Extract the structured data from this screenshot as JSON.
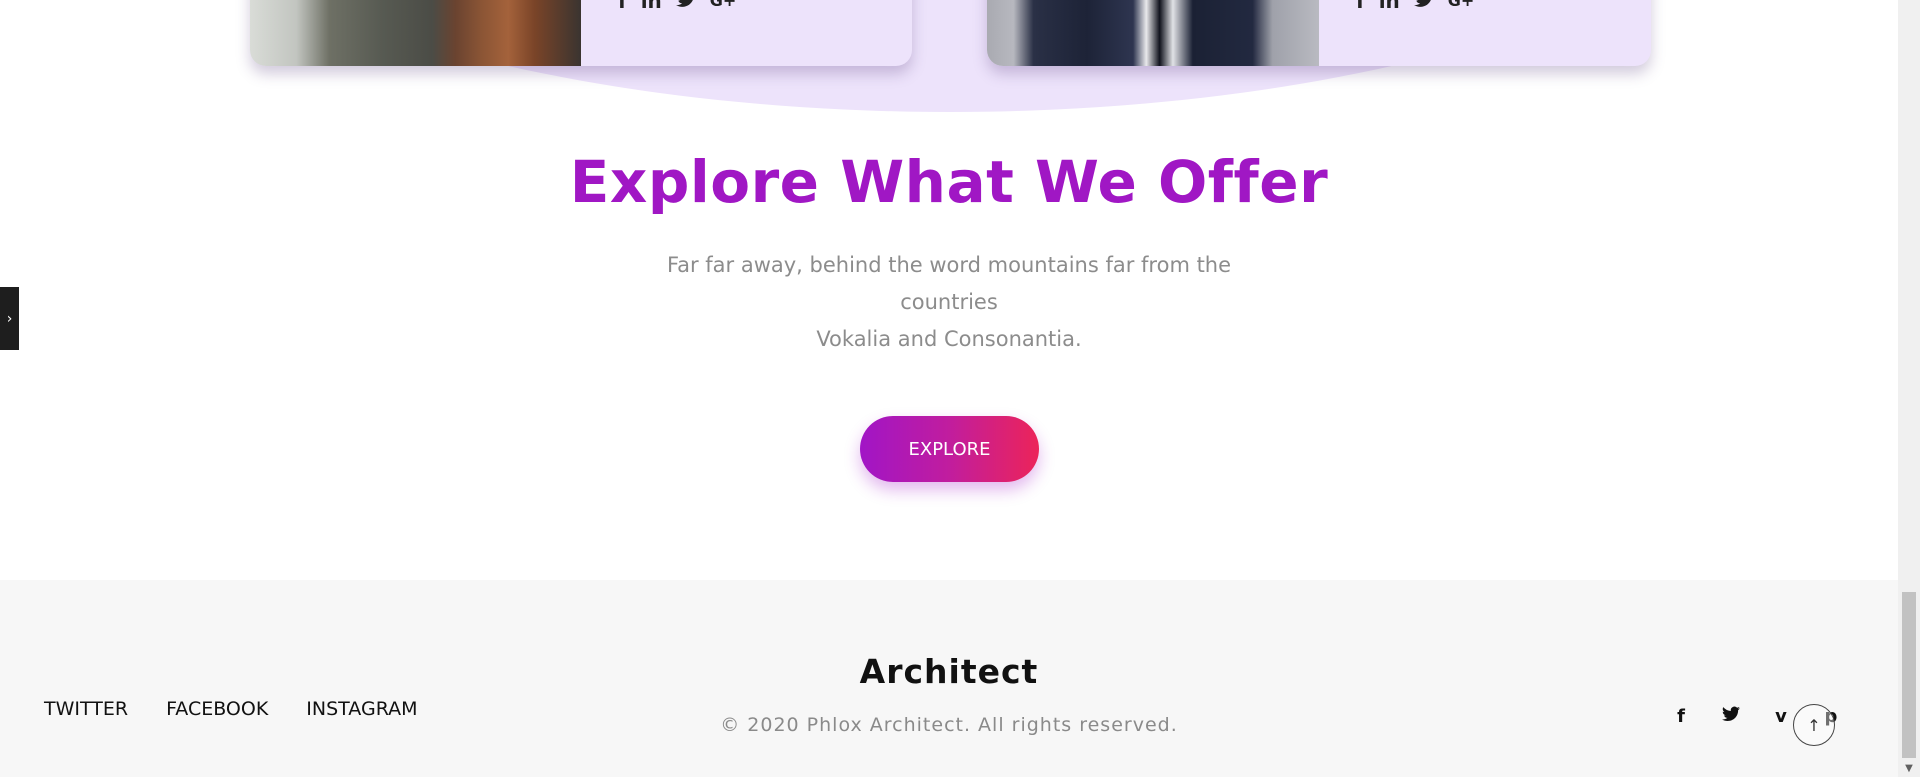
{
  "team": {
    "cards": [
      {
        "icons": [
          "facebook-icon",
          "linkedin-icon",
          "twitter-icon",
          "google-plus-icon"
        ]
      },
      {
        "icons": [
          "facebook-icon",
          "linkedin-icon",
          "twitter-icon",
          "google-plus-icon"
        ]
      }
    ],
    "icon_glyphs": {
      "facebook": "f",
      "linkedin": "in",
      "twitter": "🐦",
      "google_plus": "G+"
    }
  },
  "offer": {
    "heading": "Explore What We Offer",
    "subtitle_line1": "Far far away, behind the word mountains far from the countries",
    "subtitle_line2": "Vokalia and Consonantia.",
    "button_label": "EXPLORE"
  },
  "side_tab": {
    "glyph": "›"
  },
  "footer": {
    "links": [
      "TWITTER",
      "FACEBOOK",
      "INSTAGRAM"
    ],
    "brand": "Architect",
    "copyright": "© 2020 Phlox Architect. All rights reserved.",
    "social_icons": [
      "facebook-icon",
      "twitter-icon",
      "vimeo-icon",
      "pinterest-icon"
    ],
    "social_glyphs": {
      "facebook": "f",
      "twitter": "🐦",
      "vimeo": "v",
      "pinterest": "p"
    },
    "to_top_glyph": "↑"
  },
  "scrollbar": {
    "up": "▲",
    "down": "▼"
  },
  "colors": {
    "accent_purple": "#a017c4",
    "button_gradient_start": "#a115c6",
    "button_gradient_end": "#ec2459",
    "lavender": "#ede3fb",
    "footer_bg": "#f7f7f7"
  }
}
